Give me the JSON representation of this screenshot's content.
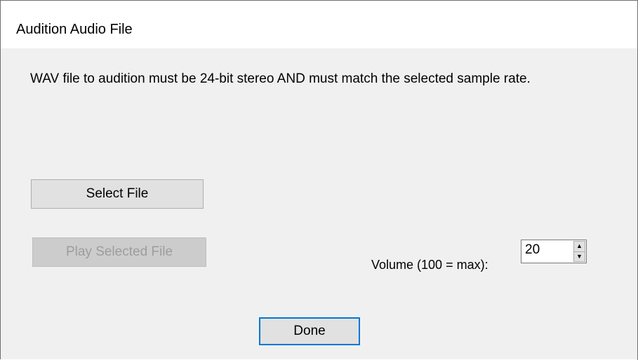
{
  "window": {
    "title": "Audition Audio File"
  },
  "content": {
    "instruction": "WAV file to audition must be 24-bit stereo AND must match the selected sample rate.",
    "select_file_label": "Select File",
    "play_selected_label": "Play Selected File",
    "volume_label": "Volume (100 = max):",
    "volume_value": "20",
    "done_label": "Done"
  },
  "icons": {
    "spin_up": "up-arrow-icon",
    "spin_down": "down-arrow-icon"
  },
  "colors": {
    "focus_border": "#0078d7",
    "dialog_background": "#f0f0f0",
    "button_face": "#e1e1e1",
    "disabled_text": "#9d9d9d"
  }
}
